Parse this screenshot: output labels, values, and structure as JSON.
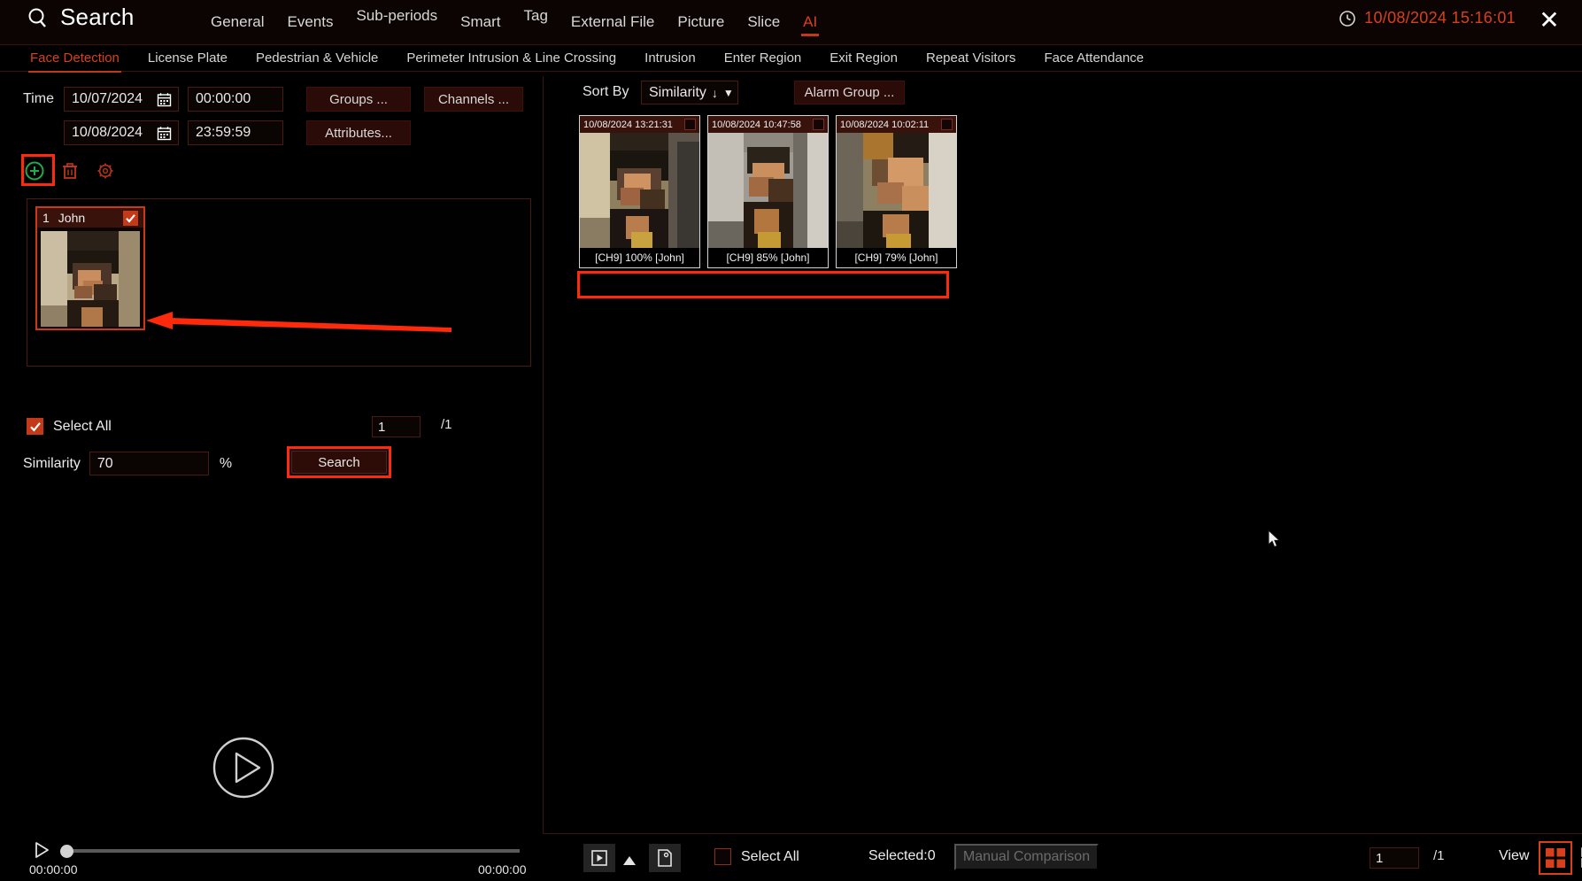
{
  "header": {
    "title": "Search",
    "search_icon": "search-icon",
    "clock_icon": "clock-icon",
    "datetime": "10/08/2024 15:16:01",
    "close_icon": "close-icon",
    "nav": [
      {
        "label": "General",
        "active": false
      },
      {
        "label": "Events",
        "active": false
      },
      {
        "label": "Sub-periods",
        "active": false
      },
      {
        "label": "Smart",
        "active": false
      },
      {
        "label": "Tag",
        "active": false
      },
      {
        "label": "External File",
        "active": false
      },
      {
        "label": "Picture",
        "active": false
      },
      {
        "label": "Slice",
        "active": false
      },
      {
        "label": "AI",
        "active": true
      }
    ]
  },
  "subnav": [
    {
      "label": "Face Detection",
      "active": true
    },
    {
      "label": "License Plate",
      "active": false
    },
    {
      "label": "Pedestrian & Vehicle",
      "active": false
    },
    {
      "label": "Perimeter Intrusion & Line Crossing",
      "active": false
    },
    {
      "label": "Intrusion",
      "active": false
    },
    {
      "label": "Enter Region",
      "active": false
    },
    {
      "label": "Exit Region",
      "active": false
    },
    {
      "label": "Repeat Visitors",
      "active": false
    },
    {
      "label": "Face Attendance",
      "active": false
    }
  ],
  "left": {
    "time_label": "Time",
    "start_date": "10/07/2024",
    "start_time": "00:00:00",
    "end_date": "10/08/2024",
    "end_time": "23:59:59",
    "calendar_icon": "calendar-icon",
    "groups_button": "Groups ...",
    "channels_button": "Channels ...",
    "attributes_button": "Attributes...",
    "toolbar": {
      "add_icon": "add-circle-icon",
      "delete_icon": "trash-icon",
      "settings_icon": "gear-icon"
    },
    "face_card": {
      "index": "1",
      "name": "John",
      "checked": true
    },
    "select_all_label": "Select All",
    "select_all_checked": true,
    "page_current": "1",
    "page_total": "/1",
    "similarity_label": "Similarity",
    "similarity_value": "70",
    "similarity_unit": "%",
    "search_button": "Search",
    "play_icon": "play-circle-icon"
  },
  "playback": {
    "play_icon": "play-icon",
    "time_start": "00:00:00",
    "time_end": "00:00:00"
  },
  "right": {
    "sort_by_label": "Sort By",
    "sort_by_value": "Similarity",
    "sort_direction_icon": "arrow-down-icon",
    "sort_chevron_icon": "chevron-down-icon",
    "alarm_group_button": "Alarm Group ...",
    "results": [
      {
        "timestamp": "10/08/2024 13:21:31",
        "caption": "[CH9] 100% [John]",
        "checked": false
      },
      {
        "timestamp": "10/08/2024 10:47:58",
        "caption": "[CH9] 85% [John]",
        "checked": false
      },
      {
        "timestamp": "10/08/2024 10:02:11",
        "caption": "[CH9] 79% [John]",
        "checked": false
      }
    ]
  },
  "bottom": {
    "playback_icon": "play-box-icon",
    "expand_icon": "triangle-up-icon",
    "backup_icon": "backup-file-icon",
    "select_all_label": "Select All",
    "select_all_checked": false,
    "selected_label": "Selected:0",
    "manual_comparison_button": "Manual Comparison",
    "page_current": "1",
    "page_total": "/1",
    "view_label": "View",
    "view_modes": [
      {
        "icon": "grid-2x2-icon",
        "active": true
      },
      {
        "icon": "grid-4-panel-icon",
        "active": false
      },
      {
        "icon": "grid-detail-icon",
        "active": false
      },
      {
        "icon": "list-view-icon",
        "active": false
      },
      {
        "icon": "refresh-loop-icon",
        "active": false
      }
    ]
  },
  "colors": {
    "accent_red": "#d8401c",
    "highlight_red": "#ff2a0c",
    "panel_dark": "#2a0b07",
    "background": "#000000"
  }
}
